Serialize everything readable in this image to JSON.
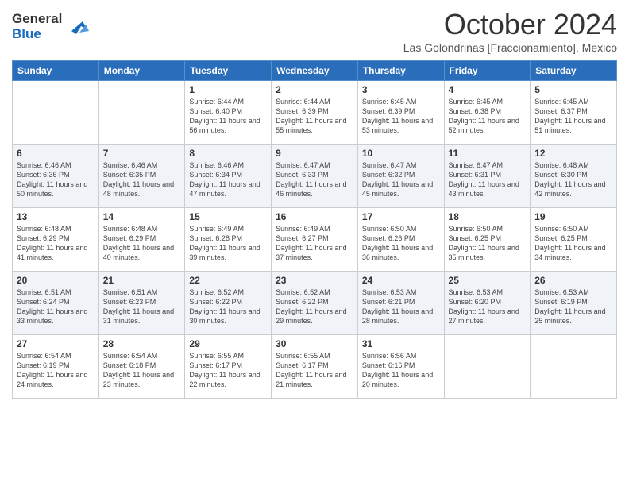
{
  "header": {
    "logo_line1": "General",
    "logo_line2": "Blue",
    "month_title": "October 2024",
    "subtitle": "Las Golondrinas [Fraccionamiento], Mexico"
  },
  "weekdays": [
    "Sunday",
    "Monday",
    "Tuesday",
    "Wednesday",
    "Thursday",
    "Friday",
    "Saturday"
  ],
  "weeks": [
    [
      {
        "day": "",
        "info": ""
      },
      {
        "day": "",
        "info": ""
      },
      {
        "day": "1",
        "info": "Sunrise: 6:44 AM\nSunset: 6:40 PM\nDaylight: 11 hours and 56 minutes."
      },
      {
        "day": "2",
        "info": "Sunrise: 6:44 AM\nSunset: 6:39 PM\nDaylight: 11 hours and 55 minutes."
      },
      {
        "day": "3",
        "info": "Sunrise: 6:45 AM\nSunset: 6:39 PM\nDaylight: 11 hours and 53 minutes."
      },
      {
        "day": "4",
        "info": "Sunrise: 6:45 AM\nSunset: 6:38 PM\nDaylight: 11 hours and 52 minutes."
      },
      {
        "day": "5",
        "info": "Sunrise: 6:45 AM\nSunset: 6:37 PM\nDaylight: 11 hours and 51 minutes."
      }
    ],
    [
      {
        "day": "6",
        "info": "Sunrise: 6:46 AM\nSunset: 6:36 PM\nDaylight: 11 hours and 50 minutes."
      },
      {
        "day": "7",
        "info": "Sunrise: 6:46 AM\nSunset: 6:35 PM\nDaylight: 11 hours and 48 minutes."
      },
      {
        "day": "8",
        "info": "Sunrise: 6:46 AM\nSunset: 6:34 PM\nDaylight: 11 hours and 47 minutes."
      },
      {
        "day": "9",
        "info": "Sunrise: 6:47 AM\nSunset: 6:33 PM\nDaylight: 11 hours and 46 minutes."
      },
      {
        "day": "10",
        "info": "Sunrise: 6:47 AM\nSunset: 6:32 PM\nDaylight: 11 hours and 45 minutes."
      },
      {
        "day": "11",
        "info": "Sunrise: 6:47 AM\nSunset: 6:31 PM\nDaylight: 11 hours and 43 minutes."
      },
      {
        "day": "12",
        "info": "Sunrise: 6:48 AM\nSunset: 6:30 PM\nDaylight: 11 hours and 42 minutes."
      }
    ],
    [
      {
        "day": "13",
        "info": "Sunrise: 6:48 AM\nSunset: 6:29 PM\nDaylight: 11 hours and 41 minutes."
      },
      {
        "day": "14",
        "info": "Sunrise: 6:48 AM\nSunset: 6:29 PM\nDaylight: 11 hours and 40 minutes."
      },
      {
        "day": "15",
        "info": "Sunrise: 6:49 AM\nSunset: 6:28 PM\nDaylight: 11 hours and 39 minutes."
      },
      {
        "day": "16",
        "info": "Sunrise: 6:49 AM\nSunset: 6:27 PM\nDaylight: 11 hours and 37 minutes."
      },
      {
        "day": "17",
        "info": "Sunrise: 6:50 AM\nSunset: 6:26 PM\nDaylight: 11 hours and 36 minutes."
      },
      {
        "day": "18",
        "info": "Sunrise: 6:50 AM\nSunset: 6:25 PM\nDaylight: 11 hours and 35 minutes."
      },
      {
        "day": "19",
        "info": "Sunrise: 6:50 AM\nSunset: 6:25 PM\nDaylight: 11 hours and 34 minutes."
      }
    ],
    [
      {
        "day": "20",
        "info": "Sunrise: 6:51 AM\nSunset: 6:24 PM\nDaylight: 11 hours and 33 minutes."
      },
      {
        "day": "21",
        "info": "Sunrise: 6:51 AM\nSunset: 6:23 PM\nDaylight: 11 hours and 31 minutes."
      },
      {
        "day": "22",
        "info": "Sunrise: 6:52 AM\nSunset: 6:22 PM\nDaylight: 11 hours and 30 minutes."
      },
      {
        "day": "23",
        "info": "Sunrise: 6:52 AM\nSunset: 6:22 PM\nDaylight: 11 hours and 29 minutes."
      },
      {
        "day": "24",
        "info": "Sunrise: 6:53 AM\nSunset: 6:21 PM\nDaylight: 11 hours and 28 minutes."
      },
      {
        "day": "25",
        "info": "Sunrise: 6:53 AM\nSunset: 6:20 PM\nDaylight: 11 hours and 27 minutes."
      },
      {
        "day": "26",
        "info": "Sunrise: 6:53 AM\nSunset: 6:19 PM\nDaylight: 11 hours and 25 minutes."
      }
    ],
    [
      {
        "day": "27",
        "info": "Sunrise: 6:54 AM\nSunset: 6:19 PM\nDaylight: 11 hours and 24 minutes."
      },
      {
        "day": "28",
        "info": "Sunrise: 6:54 AM\nSunset: 6:18 PM\nDaylight: 11 hours and 23 minutes."
      },
      {
        "day": "29",
        "info": "Sunrise: 6:55 AM\nSunset: 6:17 PM\nDaylight: 11 hours and 22 minutes."
      },
      {
        "day": "30",
        "info": "Sunrise: 6:55 AM\nSunset: 6:17 PM\nDaylight: 11 hours and 21 minutes."
      },
      {
        "day": "31",
        "info": "Sunrise: 6:56 AM\nSunset: 6:16 PM\nDaylight: 11 hours and 20 minutes."
      },
      {
        "day": "",
        "info": ""
      },
      {
        "day": "",
        "info": ""
      }
    ]
  ]
}
